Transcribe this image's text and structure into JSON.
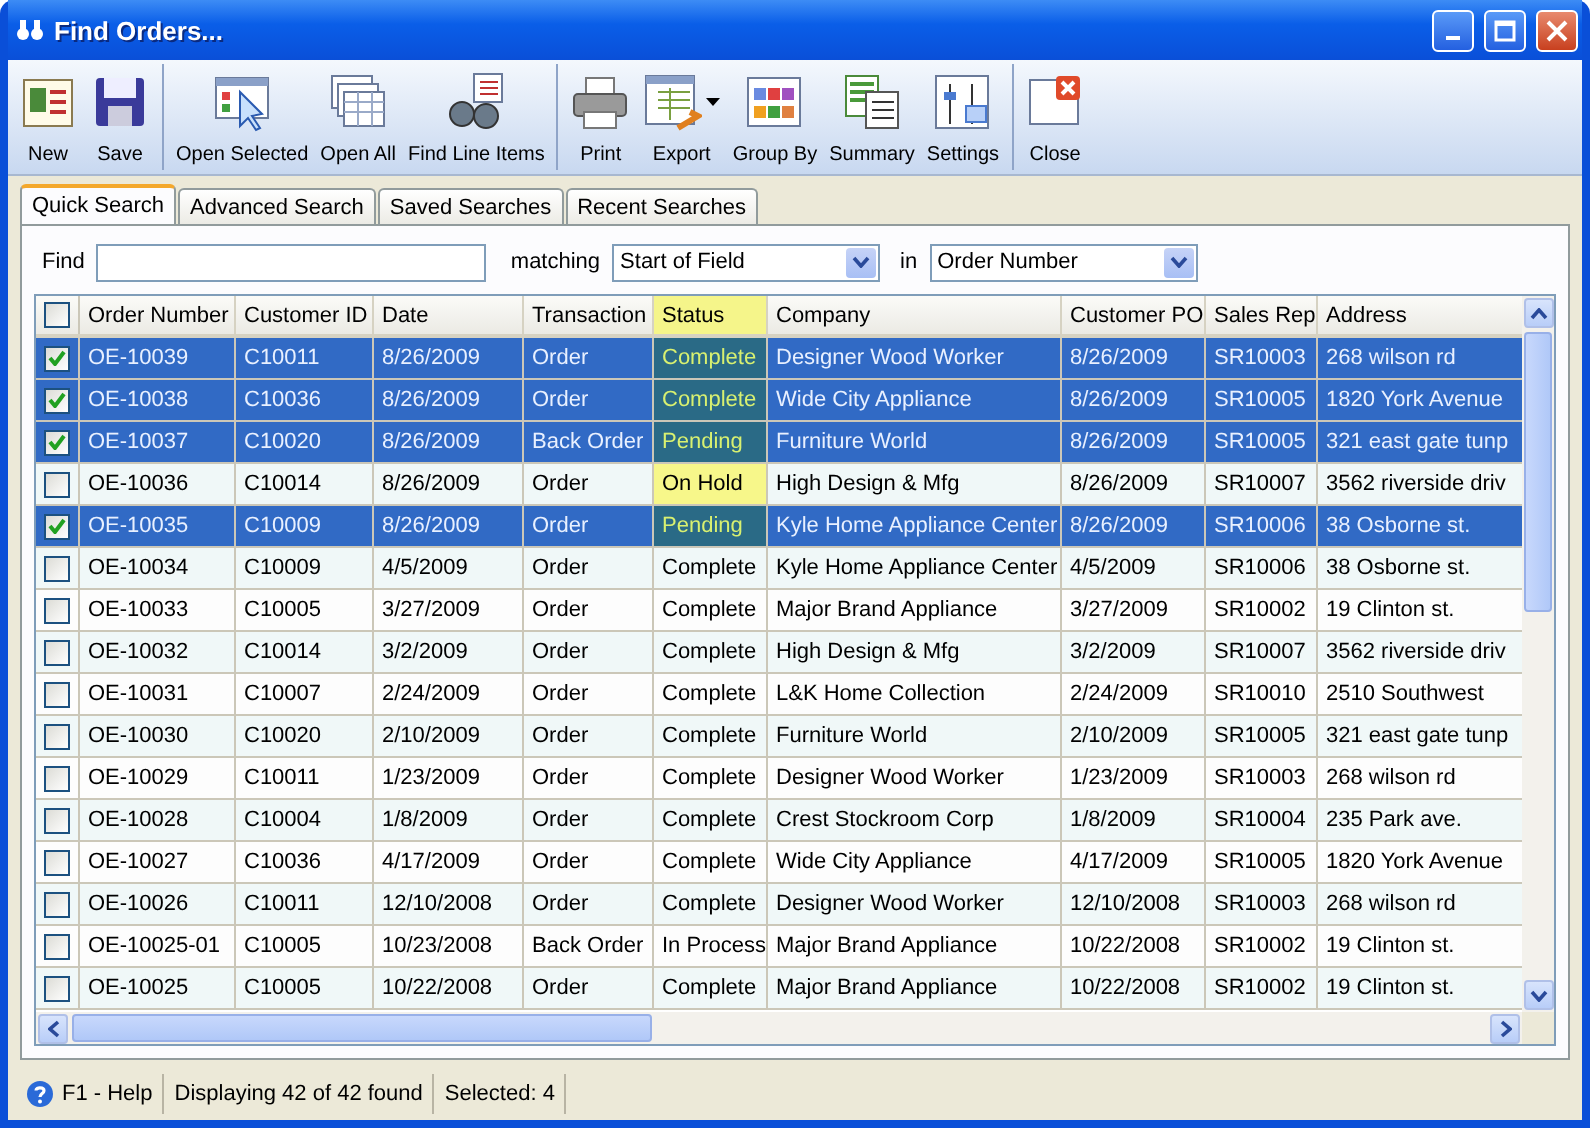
{
  "window": {
    "title": "Find Orders..."
  },
  "toolbar": {
    "groups": [
      {
        "items": [
          {
            "label": "New",
            "has_menu": false
          },
          {
            "label": "Save",
            "has_menu": false
          }
        ]
      },
      {
        "items": [
          {
            "label": "Open Selected",
            "has_menu": false
          },
          {
            "label": "Open All",
            "has_menu": false
          },
          {
            "label": "Find Line Items",
            "has_menu": false
          }
        ]
      },
      {
        "items": [
          {
            "label": "Print",
            "has_menu": false
          },
          {
            "label": "Export",
            "has_menu": true
          },
          {
            "label": "Group By",
            "has_menu": false
          },
          {
            "label": "Summary",
            "has_menu": false
          },
          {
            "label": "Settings",
            "has_menu": false
          }
        ]
      },
      {
        "items": [
          {
            "label": "Close",
            "has_menu": false
          }
        ]
      }
    ]
  },
  "tabs": [
    {
      "label": "Quick Search",
      "selected": true
    },
    {
      "label": "Advanced Search",
      "selected": false
    },
    {
      "label": "Saved Searches",
      "selected": false
    },
    {
      "label": "Recent Searches",
      "selected": false
    }
  ],
  "search": {
    "find_label": "Find",
    "matching_label": "matching",
    "matching_value": "Start of Field",
    "in_label": "in",
    "in_value": "Order Number"
  },
  "table": {
    "select_all_checked": false,
    "columns": [
      {
        "label": "Order Number",
        "highlighted": false
      },
      {
        "label": "Customer ID",
        "highlighted": false
      },
      {
        "label": "Date",
        "highlighted": false
      },
      {
        "label": "Transaction",
        "highlighted": false
      },
      {
        "label": "Status",
        "highlighted": true
      },
      {
        "label": "Company",
        "highlighted": false
      },
      {
        "label": "Customer PO",
        "highlighted": false
      },
      {
        "label": "Sales Rep",
        "highlighted": false
      },
      {
        "label": "Address",
        "highlighted": false
      }
    ],
    "rows": [
      {
        "checked": true,
        "selected": true,
        "highlighted": true,
        "cells": [
          "OE-10039",
          "C10011",
          "8/26/2009",
          "Order",
          "Complete",
          "Designer Wood Worker",
          "8/26/2009",
          "SR10003",
          "268 wilson rd"
        ]
      },
      {
        "checked": true,
        "selected": true,
        "highlighted": true,
        "cells": [
          "OE-10038",
          "C10036",
          "8/26/2009",
          "Order",
          "Complete",
          "Wide City Appliance",
          "8/26/2009",
          "SR10005",
          "1820 York Avenue"
        ]
      },
      {
        "checked": true,
        "selected": true,
        "highlighted": true,
        "cells": [
          "OE-10037",
          "C10020",
          "8/26/2009",
          "Back Order",
          "Pending",
          "Furniture World",
          "8/26/2009",
          "SR10005",
          "321 east gate tunp"
        ]
      },
      {
        "checked": false,
        "selected": false,
        "highlighted": true,
        "cells": [
          "OE-10036",
          "C10014",
          "8/26/2009",
          "Order",
          "On Hold",
          "High Design & Mfg",
          "8/26/2009",
          "SR10007",
          "3562 riverside driv"
        ]
      },
      {
        "checked": true,
        "selected": true,
        "highlighted": true,
        "cells": [
          "OE-10035",
          "C10009",
          "8/26/2009",
          "Order",
          "Pending",
          "Kyle Home Appliance Center",
          "8/26/2009",
          "SR10006",
          "38 Osborne st."
        ]
      },
      {
        "checked": false,
        "selected": false,
        "highlighted": false,
        "cells": [
          "OE-10034",
          "C10009",
          "4/5/2009",
          "Order",
          "Complete",
          "Kyle Home Appliance Center",
          "4/5/2009",
          "SR10006",
          "38 Osborne st."
        ]
      },
      {
        "checked": false,
        "selected": false,
        "highlighted": false,
        "cells": [
          "OE-10033",
          "C10005",
          "3/27/2009",
          "Order",
          "Complete",
          "Major Brand Appliance",
          "3/27/2009",
          "SR10002",
          "19 Clinton st."
        ]
      },
      {
        "checked": false,
        "selected": false,
        "highlighted": false,
        "cells": [
          "OE-10032",
          "C10014",
          "3/2/2009",
          "Order",
          "Complete",
          "High Design & Mfg",
          "3/2/2009",
          "SR10007",
          "3562 riverside driv"
        ]
      },
      {
        "checked": false,
        "selected": false,
        "highlighted": false,
        "cells": [
          "OE-10031",
          "C10007",
          "2/24/2009",
          "Order",
          "Complete",
          "L&K Home Collection",
          "2/24/2009",
          "SR10010",
          "2510 Southwest"
        ]
      },
      {
        "checked": false,
        "selected": false,
        "highlighted": false,
        "cells": [
          "OE-10030",
          "C10020",
          "2/10/2009",
          "Order",
          "Complete",
          "Furniture World",
          "2/10/2009",
          "SR10005",
          "321 east gate tunp"
        ]
      },
      {
        "checked": false,
        "selected": false,
        "highlighted": false,
        "cells": [
          "OE-10029",
          "C10011",
          "1/23/2009",
          "Order",
          "Complete",
          "Designer Wood Worker",
          "1/23/2009",
          "SR10003",
          "268 wilson rd"
        ]
      },
      {
        "checked": false,
        "selected": false,
        "highlighted": false,
        "cells": [
          "OE-10028",
          "C10004",
          "1/8/2009",
          "Order",
          "Complete",
          "Crest Stockroom Corp",
          "1/8/2009",
          "SR10004",
          "235 Park ave."
        ]
      },
      {
        "checked": false,
        "selected": false,
        "highlighted": false,
        "cells": [
          "OE-10027",
          "C10036",
          "4/17/2009",
          "Order",
          "Complete",
          "Wide City Appliance",
          "4/17/2009",
          "SR10005",
          "1820 York Avenue"
        ]
      },
      {
        "checked": false,
        "selected": false,
        "highlighted": false,
        "cells": [
          "OE-10026",
          "C10011",
          "12/10/2008",
          "Order",
          "Complete",
          "Designer Wood Worker",
          "12/10/2008",
          "SR10003",
          "268 wilson rd"
        ]
      },
      {
        "checked": false,
        "selected": false,
        "highlighted": false,
        "cells": [
          "OE-10025-01",
          "C10005",
          "10/23/2008",
          "Back Order",
          "In Process",
          "Major Brand Appliance",
          "10/22/2008",
          "SR10002",
          "19 Clinton st."
        ]
      },
      {
        "checked": false,
        "selected": false,
        "highlighted": false,
        "cells": [
          "OE-10025",
          "C10005",
          "10/22/2008",
          "Order",
          "Complete",
          "Major Brand Appliance",
          "10/22/2008",
          "SR10002",
          "19 Clinton st."
        ]
      }
    ]
  },
  "status_bar": {
    "help": "F1 - Help",
    "displaying": "Displaying 42 of 42 found",
    "selected": "Selected: 4"
  }
}
